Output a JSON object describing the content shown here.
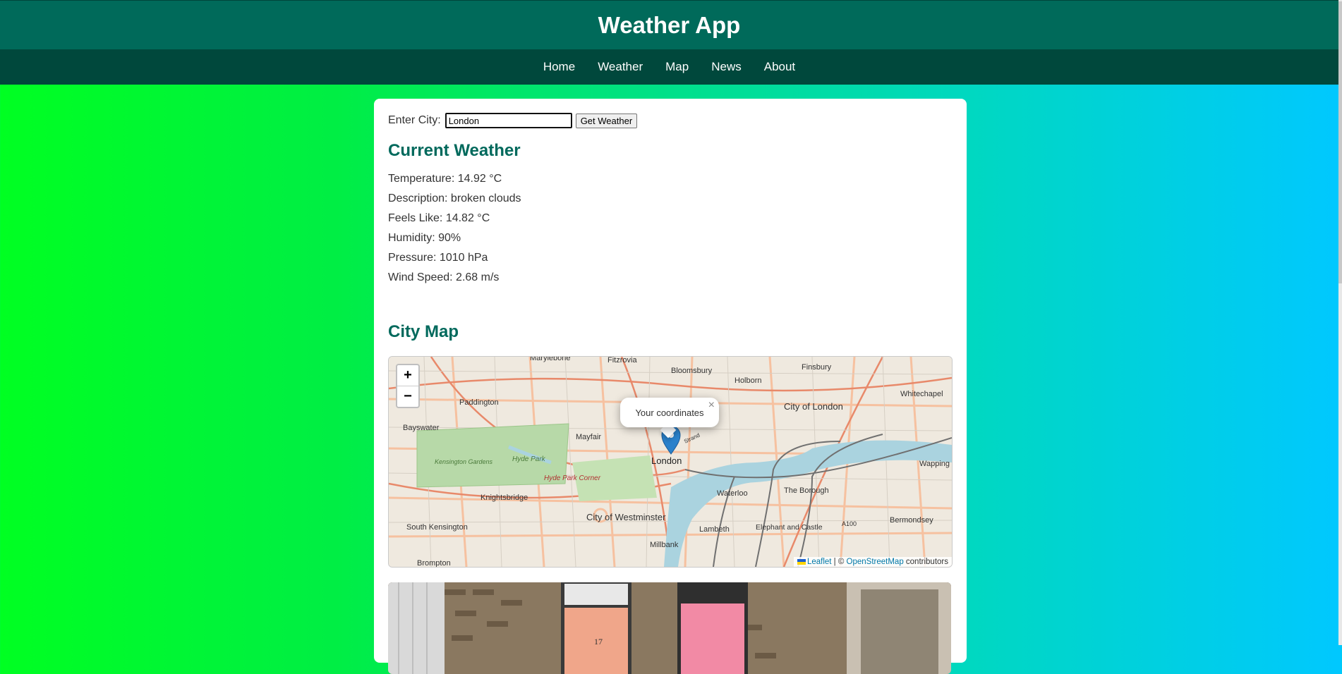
{
  "app": {
    "title": "Weather App"
  },
  "nav": [
    "Home",
    "Weather",
    "Map",
    "News",
    "About"
  ],
  "search": {
    "label": "Enter City:",
    "value": "London",
    "button": "Get Weather"
  },
  "current": {
    "heading": "Current Weather",
    "temperature": "Temperature: 14.92 °C",
    "description": "Description: broken clouds",
    "feels_like": "Feels Like: 14.82 °C",
    "humidity": "Humidity: 90%",
    "pressure": "Pressure: 1010 hPa",
    "wind": "Wind Speed: 2.68 m/s"
  },
  "map": {
    "heading": "City Map",
    "zoom_in": "+",
    "zoom_out": "−",
    "popup_text": "Your coordinates",
    "popup_close": "×",
    "attribution": {
      "leaflet": "Leaflet",
      "sep": " | © ",
      "osm": "OpenStreetMap",
      "suffix": " contributors"
    },
    "labels": [
      "Marylebone",
      "Fitzrovia",
      "Bloomsbury",
      "Holborn",
      "Finsbury",
      "Whitechapel",
      "Paddington",
      "City of London",
      "Bayswater",
      "Mayfair",
      "London",
      "Kensington Gardens",
      "Hyde Park",
      "Hyde Park Corner",
      "Knightsbridge",
      "Waterloo",
      "The Borough",
      "Wapping",
      "City of Westminster",
      "South Kensington",
      "Lambeth",
      "Elephant and Castle",
      "Bermondsey",
      "Millbank",
      "Brompton",
      "Strand",
      "A100"
    ]
  }
}
